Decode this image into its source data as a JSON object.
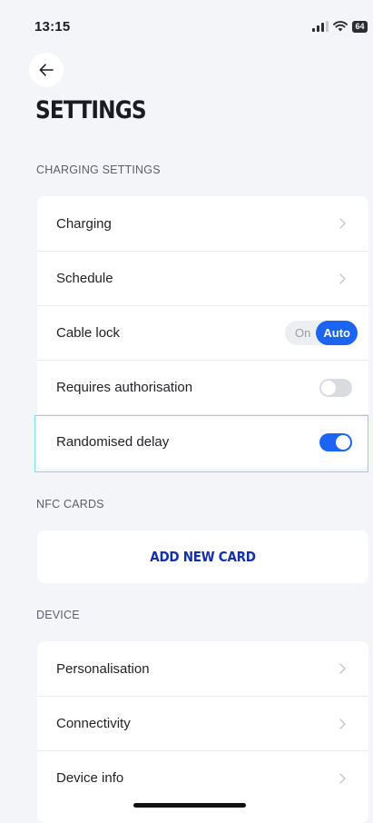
{
  "status_bar": {
    "time": "13:15",
    "battery_level": "64",
    "icons": [
      "signal-icon",
      "wifi-icon",
      "battery-icon"
    ]
  },
  "header": {
    "back_icon": "arrow-left-icon",
    "title": "SETTINGS"
  },
  "charging_settings": {
    "heading": "CHARGING SETTINGS",
    "charging_label": "Charging",
    "schedule_label": "Schedule",
    "cable_lock": {
      "label": "Cable lock",
      "options": [
        "On",
        "Auto"
      ],
      "selected": "Auto"
    },
    "requires_authorisation": {
      "label": "Requires authorisation",
      "enabled": false
    },
    "randomised_delay": {
      "label": "Randomised delay",
      "enabled": true
    }
  },
  "nfc_cards": {
    "heading": "NFC CARDS",
    "add_card_label": "ADD NEW CARD"
  },
  "device": {
    "heading": "DEVICE",
    "items": [
      {
        "label": "Personalisation"
      },
      {
        "label": "Connectivity"
      },
      {
        "label": "Device info"
      }
    ]
  },
  "colors": {
    "accent": "#1c64f2",
    "background": "#f4f5f9",
    "card": "#ffffff",
    "highlight": "#7cdcec",
    "link": "#1530a6"
  }
}
